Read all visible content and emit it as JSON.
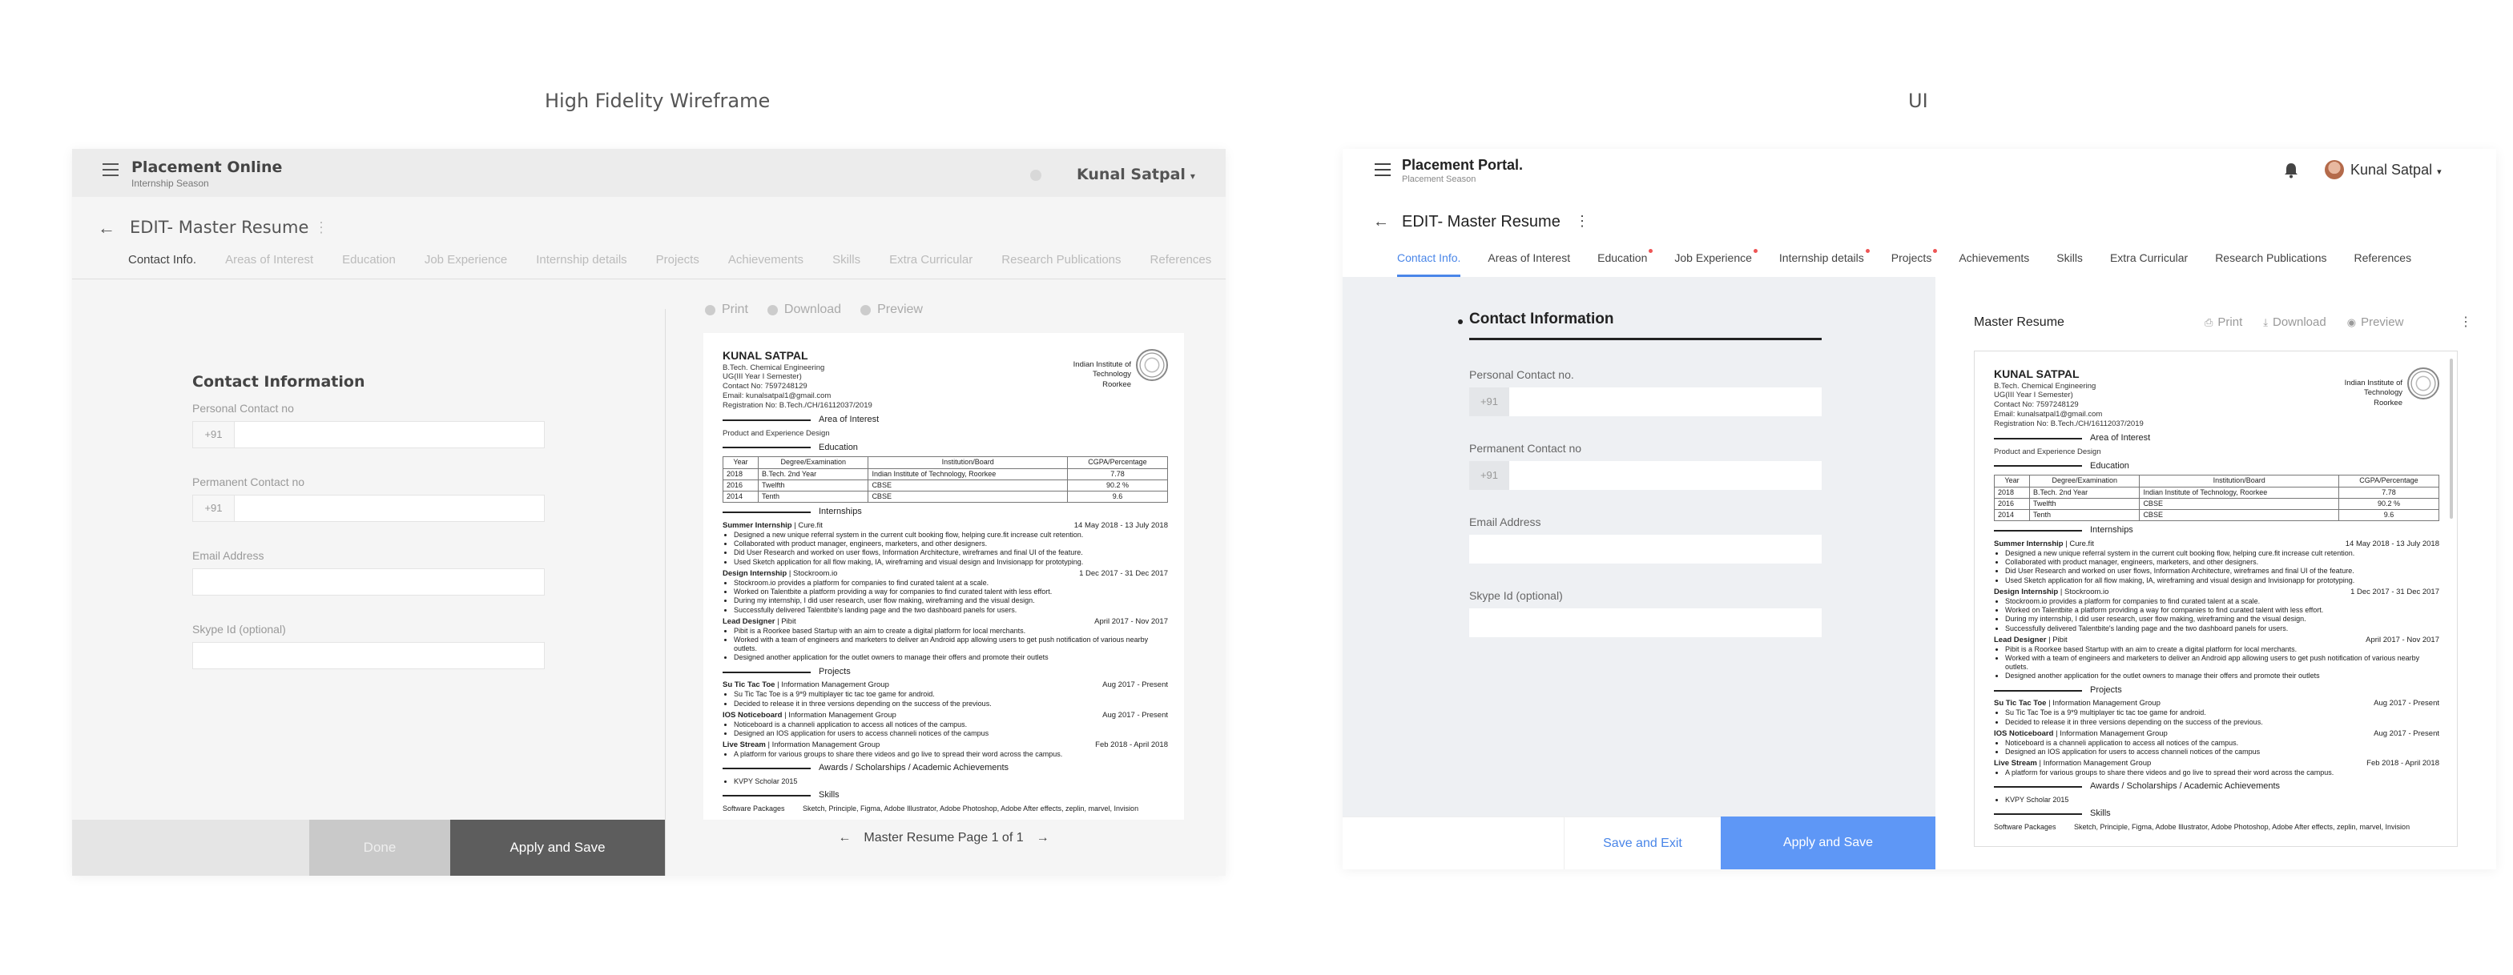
{
  "headers": {
    "wireframe": "High Fidelity Wireframe",
    "ui": "UI"
  },
  "wireframe": {
    "app_name": "Placement Online",
    "app_subtitle": "Internship Season",
    "user_name": "Kunal Satpal",
    "page_title": "EDIT- Master Resume",
    "tabs": [
      "Contact Info.",
      "Areas of Interest",
      "Education",
      "Job Experience",
      "Internship details",
      "Projects",
      "Achievements",
      "Skills",
      "Extra Curricular",
      "Research Publications",
      "References"
    ],
    "form_title": "Contact Information",
    "fields": {
      "personal_label": "Personal Contact no",
      "personal_prefix": "+91",
      "permanent_label": "Permanent Contact no",
      "permanent_prefix": "+91",
      "email_label": "Email Address",
      "skype_label": "Skype Id (optional)"
    },
    "buttons": {
      "done": "Done",
      "apply": "Apply and Save"
    },
    "preview_actions": [
      "Print",
      "Download",
      "Preview"
    ],
    "pager": {
      "prev": "←",
      "label": "Master Resume Page 1 of 1",
      "next": "→"
    }
  },
  "ui": {
    "app_name": "Placement Portal.",
    "app_subtitle": "Placement Season",
    "user_name": "Kunal Satpal",
    "page_title": "EDIT- Master Resume",
    "tabs": [
      "Contact Info.",
      "Areas of Interest",
      "Education",
      "Job Experience",
      "Internship details",
      "Projects",
      "Achievements",
      "Skills",
      "Extra Curricular",
      "Research Publications",
      "References"
    ],
    "required_tabs": [
      2,
      3,
      4,
      5
    ],
    "form_title": "Contact Information",
    "fields": {
      "personal_label": "Personal Contact no.",
      "personal_prefix": "+91",
      "permanent_label": "Permanent Contact no",
      "permanent_prefix": "+91",
      "email_label": "Email Address",
      "skype_label": "Skype Id (optional)"
    },
    "buttons": {
      "save_exit": "Save and Exit",
      "apply": "Apply and Save"
    },
    "preview_title": "Master Resume",
    "preview_actions": [
      "Print",
      "Download",
      "Preview"
    ],
    "accent_color": "#5e97f6"
  },
  "resume": {
    "name": "KUNAL SATPAL",
    "lines": [
      "B.Tech. Chemical Engineering",
      "UG(III Year I Semester)",
      "Contact No: 7597248129",
      "Email: kunalsatpal1@gmail.com",
      "Registration No: B.Tech./CH/16112037/2019"
    ],
    "institute": [
      "Indian Institute of",
      "Technology",
      "Roorkee"
    ],
    "area_title": "Area of Interest",
    "area_text": "Product and Experience Design",
    "education_title": "Education",
    "edu_headers": [
      "Year",
      "Degree/Examination",
      "Institution/Board",
      "CGPA/Percentage"
    ],
    "edu_rows": [
      [
        "2018",
        "B.Tech. 2nd Year",
        "Indian Institute of Technology, Roorkee",
        "7.78"
      ],
      [
        "2016",
        "Twelfth",
        "CBSE",
        "90.2 %"
      ],
      [
        "2014",
        "Tenth",
        "CBSE",
        "9.6"
      ]
    ],
    "internships_title": "Internships",
    "internships": [
      {
        "role": "Summer Internship",
        "org": "Cure.fit",
        "dates": "14 May 2018 - 13 July 2018",
        "bullets": [
          "Designed a new unique referral system in the current cult booking flow, helping cure.fit increase cult retention.",
          "Collaborated with product manager, engineers, marketers, and other designers.",
          "Did User Research and worked on user flows, Information Architecture, wireframes and final UI of the feature.",
          "Used Sketch application for all flow making, IA, wireframing and visual design and Invisionapp for prototyping."
        ]
      },
      {
        "role": "Design Internship",
        "org": "Stockroom.io",
        "dates": "1 Dec 2017 - 31 Dec 2017",
        "bullets": [
          "Stockroom.io provides a platform for companies to find curated talent at a scale.",
          "Worked on Talentbite a platform providing a way for companies to find curated talent with less effort.",
          "During my internship, I did user research, user flow making, wireframing and the visual design.",
          "Successfully delivered Talentbite's landing page and the two dashboard panels for users."
        ]
      },
      {
        "role": "Lead Designer",
        "org": "Pibit",
        "dates": "April 2017 - Nov 2017",
        "bullets": [
          "Pibit is a Roorkee based Startup with an aim to create a digital platform for local merchants.",
          "Worked with a team of engineers and marketers to deliver an Android app allowing users to get push notification of various nearby outlets.",
          "Designed another application for the outlet owners to manage their offers and promote their outlets"
        ]
      }
    ],
    "projects_title": "Projects",
    "projects": [
      {
        "role": "Su Tic Tac Toe",
        "org": "Information Management Group",
        "dates": "Aug 2017 - Present",
        "bullets": [
          "Su Tic Tac Toe is a 9*9 multiplayer tic tac toe game for android.",
          "Decided to release it in three versions depending on the success of the previous."
        ]
      },
      {
        "role": "IOS Noticeboard",
        "org": "Information Management Group",
        "dates": "Aug 2017 - Present",
        "bullets": [
          "Noticeboard is a channeli application to access all notices of the campus.",
          "Designed an IOS application for users to access channeli notices of the campus"
        ]
      },
      {
        "role": "Live Stream",
        "org": "Information Management Group",
        "dates": "Feb 2018 - April 2018",
        "bullets": [
          "A platform for various groups to share there videos and go live to spread their word across the campus."
        ]
      }
    ],
    "awards_title": "Awards / Scholarships / Academic Achievements",
    "awards": [
      "KVPY Scholar 2015"
    ],
    "skills_title": "Skills",
    "skills_key": "Software Packages",
    "skills_value": "Sketch, Principle, Figma, Adobe Illustrator, Adobe Photoshop, Adobe After effects, zeplin, marvel, Invision"
  }
}
